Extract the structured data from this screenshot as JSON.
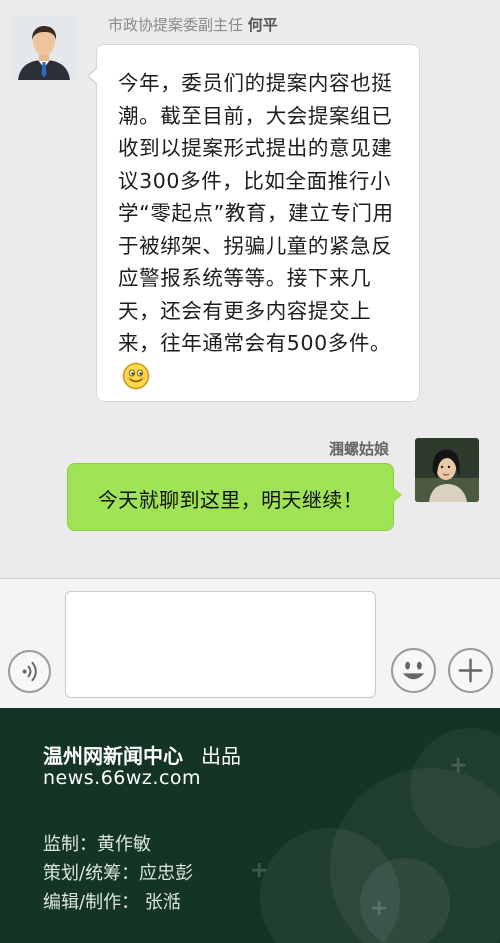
{
  "messages": [
    {
      "sender_title": "市政协提案委副主任",
      "sender_name": "何平",
      "text": "今年，委员们的提案内容也挺潮。截至目前，大会提案组已收到以提案形式提出的意见建议300多件，比如全面推行小学“零起点”教育，建立专门用于被绑架、拐骗儿童的紧急反应警报系统等等。接下来几天，还会有更多内容提交上来，往年通常会有500多件。",
      "emoji": "smile-emoji"
    },
    {
      "sender_name": "涠螺姑娘",
      "text": "今天就聊到这里，明天继续！"
    }
  ],
  "input_bar": {
    "voice_icon": "voice-icon",
    "emoji_icon": "emoji-icon",
    "plus_icon": "plus-icon"
  },
  "footer": {
    "org": "温州网新闻中心",
    "published": "出品",
    "url": "news.66wz.com",
    "credits": [
      "监制：黄作敏",
      "策划/统筹：应忠彭",
      "编辑/制作： 张湉"
    ]
  },
  "colors": {
    "chat_bg": "#ebebeb",
    "incoming_bubble": "#ffffff",
    "outgoing_bubble": "#9fe357",
    "footer_bg": "#143425"
  }
}
